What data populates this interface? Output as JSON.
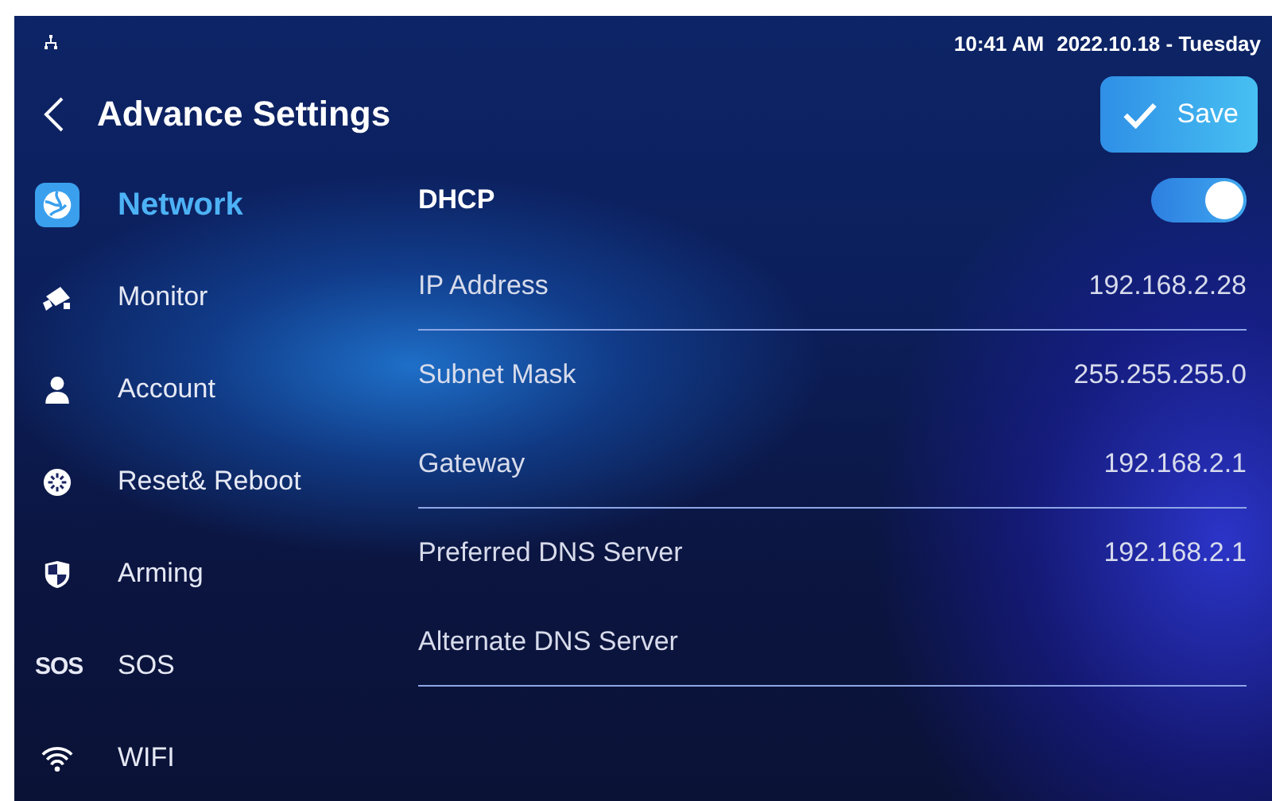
{
  "status_bar": {
    "time": "10:41 AM",
    "date": "2022.10.18 - Tuesday"
  },
  "header": {
    "title": "Advance Settings",
    "save_label": "Save"
  },
  "sidebar": {
    "items": [
      {
        "label": "Network",
        "kind": "network",
        "selected": true
      },
      {
        "label": "Monitor",
        "kind": "monitor",
        "selected": false
      },
      {
        "label": "Account",
        "kind": "account",
        "selected": false
      },
      {
        "label": "Reset& Reboot",
        "kind": "reset",
        "selected": false
      },
      {
        "label": "Arming",
        "kind": "arming",
        "selected": false
      },
      {
        "label": "SOS",
        "kind": "sos",
        "icon_text": "SOS",
        "selected": false
      },
      {
        "label": "WIFI",
        "kind": "wifi",
        "selected": false
      }
    ]
  },
  "settings": [
    {
      "kind": "toggle",
      "label": "DHCP",
      "on": true,
      "divider": false
    },
    {
      "kind": "field",
      "label": "IP Address",
      "value": "192.168.2.28",
      "divider": true
    },
    {
      "kind": "field",
      "label": "Subnet Mask",
      "value": "255.255.255.0",
      "divider": false
    },
    {
      "kind": "field",
      "label": "Gateway",
      "value": "192.168.2.1",
      "divider": true
    },
    {
      "kind": "field",
      "label": "Preferred DNS Server",
      "value": "192.168.2.1",
      "divider": false
    },
    {
      "kind": "field",
      "label": "Alternate DNS Server",
      "divider": true
    }
  ]
}
